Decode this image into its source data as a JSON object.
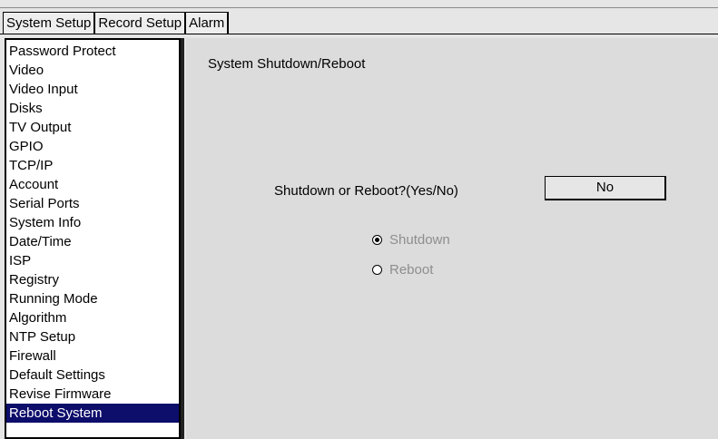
{
  "tabs": [
    {
      "label": "System Setup",
      "active": true
    },
    {
      "label": "Record Setup",
      "active": false
    },
    {
      "label": "Alarm",
      "active": false
    }
  ],
  "sidebar": {
    "items": [
      {
        "label": "Password Protect"
      },
      {
        "label": "Video"
      },
      {
        "label": "Video Input"
      },
      {
        "label": "Disks"
      },
      {
        "label": "TV Output"
      },
      {
        "label": "GPIO"
      },
      {
        "label": "TCP/IP"
      },
      {
        "label": "Account"
      },
      {
        "label": "Serial Ports"
      },
      {
        "label": "System Info"
      },
      {
        "label": "Date/Time"
      },
      {
        "label": "ISP"
      },
      {
        "label": "Registry"
      },
      {
        "label": "Running Mode"
      },
      {
        "label": "Algorithm"
      },
      {
        "label": "NTP Setup"
      },
      {
        "label": "Firewall"
      },
      {
        "label": "Default Settings"
      },
      {
        "label": "Revise Firmware"
      },
      {
        "label": "Reboot System",
        "selected": true
      }
    ]
  },
  "panel": {
    "title": "System Shutdown/Reboot",
    "question": "Shutdown or Reboot?(Yes/No)",
    "answer_button": "No",
    "options": [
      {
        "label": "Shutdown",
        "checked": true
      },
      {
        "label": "Reboot",
        "checked": false
      }
    ]
  },
  "colors": {
    "selection_bg": "#0d0d6b",
    "disabled_text": "#8e8e8e",
    "panel_bg": "#dcdcdc"
  }
}
